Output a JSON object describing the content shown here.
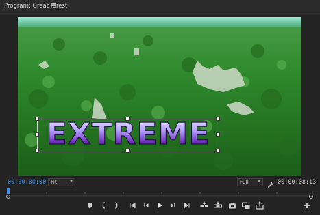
{
  "panel": {
    "title": "Program: Great forest"
  },
  "monitor": {
    "title_text": "EXTREME"
  },
  "timecode": {
    "current": "00:00:00:00",
    "duration": "00:00:08:13"
  },
  "zoom": {
    "selected": "Fit"
  },
  "resolution": {
    "selected": "Full"
  },
  "colors": {
    "timecode_accent": "#3a8ff0",
    "background": "#232323",
    "panel_header": "#2b2b2b"
  },
  "transport_icons": [
    "marker-icon",
    "mark-in-icon",
    "mark-out-icon",
    "go-to-in-icon",
    "step-back-icon",
    "play-icon",
    "step-forward-icon",
    "go-to-out-icon",
    "insert-icon",
    "overwrite-icon",
    "export-frame-icon",
    "comparison-view-icon",
    "export-icon",
    "add-button-icon"
  ]
}
